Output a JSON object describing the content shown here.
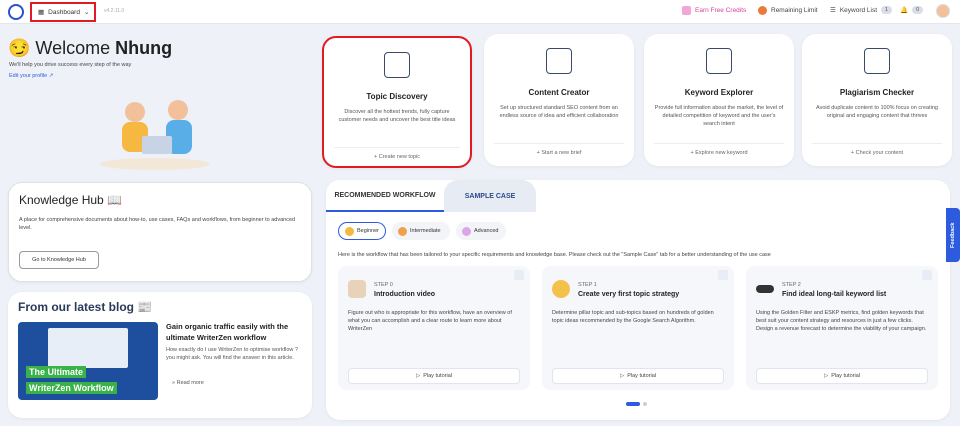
{
  "topbar": {
    "dashboard_label": "Dashboard",
    "version": "v4.2.11.0",
    "earn_credits": "Earn Free Credits",
    "remaining_limit": "Remaining Limit",
    "keyword_list": "Keyword List",
    "keyword_count": "1",
    "notif_count": "0"
  },
  "welcome": {
    "greeting": "Welcome ",
    "name": "Nhung",
    "subtitle": "We'll help you drive success every step of the way",
    "edit_profile": "Edit your profile"
  },
  "tools": [
    {
      "title": "Topic Discovery",
      "desc": "Discover all the hottest trends, fully capture customer needs and uncover the best title ideas",
      "action": "+ Create new topic"
    },
    {
      "title": "Content Creator",
      "desc": "Set up structured standard SEO content from an endless source of idea and efficient collaboration",
      "action": "+ Start a new brief"
    },
    {
      "title": "Keyword Explorer",
      "desc": "Provide full information about the market, the level of detailed competition of keyword and the user's search intent",
      "action": "+ Explore new keyword"
    },
    {
      "title": "Plagiarism Checker",
      "desc": "Avoid duplicate content to 100% focus on creating original and engaging content that thrives",
      "action": "+ Check your content"
    }
  ],
  "knowledge": {
    "title": "Knowledge Hub 📖",
    "desc": "A place for comprehensive documents about how-to, use cases, FAQs and workflows, from beginner to advanced level.",
    "button": "Go to Knowledge Hub"
  },
  "blog": {
    "title": "From our latest blog 📰",
    "img_line1": "The Ultimate",
    "img_line2": "WriterZen Workflow",
    "post_title": "Gain organic traffic easily with the ultimate WriterZen workflow",
    "post_desc": "How exactly do I use WriterZen to optimise workflow ? you might ask. You will find the answer in this article.",
    "read_more": "Read more"
  },
  "workflow": {
    "tab1": "RECOMMENDED WORKFLOW",
    "tab2": "SAMPLE CASE",
    "levels": [
      "Beginner",
      "Intermediate",
      "Advanced"
    ],
    "desc": "Here is the workflow that has been tailored to your specific requirements and knowledge base. Please check out the \"Sample Case\" tab for a better understanding of the use case",
    "steps": [
      {
        "num": "STEP 0",
        "title": "Introduction video",
        "desc": "Figure out who is appropriate for this workflow, have an overview of what you can accomplish and a clear route to learn more about WriterZen",
        "play": "Play tutorial"
      },
      {
        "num": "STEP 1",
        "title": "Create very first topic strategy",
        "desc": "Determine pillar topic and sub-topics based on hundreds of golden topic ideas recommended by the Google Search Algorithm.",
        "play": "Play tutorial"
      },
      {
        "num": "STEP 2",
        "title": "Find ideal long-tail keyword list",
        "desc": "Using the Golden Filter and ESKP metrics, find golden keywords that best suit your content strategy and resources in just a few clicks. Design a revenue forecast to determine the viability of your campaign.",
        "play": "Play tutorial"
      }
    ]
  },
  "feedback": "Feedback",
  "colors": {
    "accent": "#2c5be0",
    "highlight": "#e01b24",
    "bg": "#eef1f7"
  }
}
